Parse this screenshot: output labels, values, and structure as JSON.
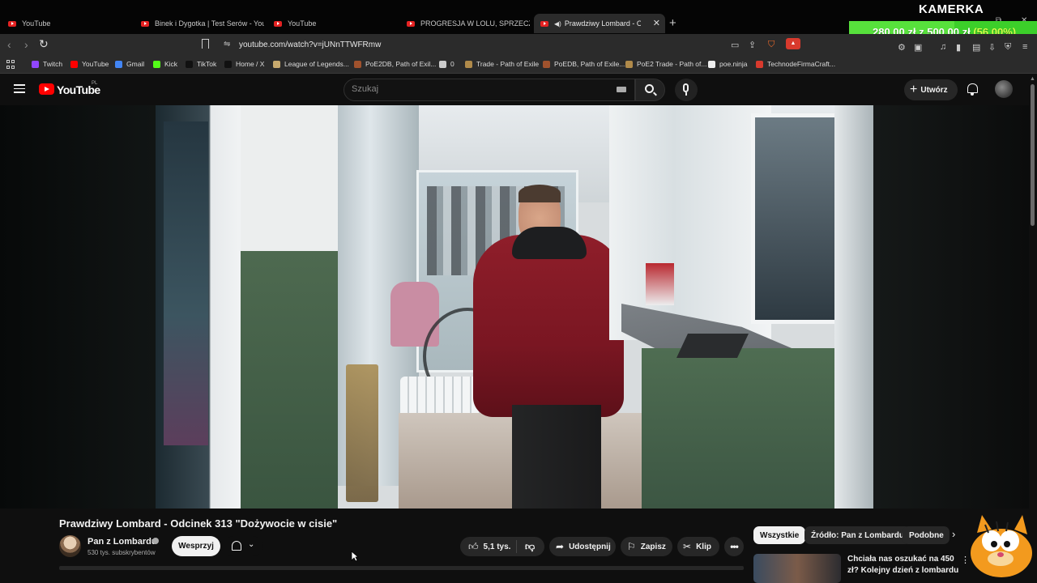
{
  "browser": {
    "tabs": [
      {
        "title": "YouTube",
        "active": false
      },
      {
        "title": "Binek i Dygotka | Test Serów - YouTube",
        "active": false
      },
      {
        "title": "YouTube",
        "active": false
      },
      {
        "title": "PROGRESJA W LOLU, SPRZECZKI Z RI",
        "active": false
      },
      {
        "title": "Prawdziwy Lombard - Odcinek",
        "active": true
      }
    ],
    "url": "youtube.com/watch?v=jUNnTTWFRmw",
    "bookmarks": [
      {
        "label": "Twitch",
        "icon": "twitch-icon",
        "color": "#9146ff"
      },
      {
        "label": "YouTube",
        "icon": "youtube-icon",
        "color": "#ff0000"
      },
      {
        "label": "Gmail",
        "icon": "google-icon",
        "color": "#4285f4"
      },
      {
        "label": "Kick",
        "icon": "kick-icon",
        "color": "#53fc18"
      },
      {
        "label": "TikTok",
        "icon": "tiktok-icon",
        "color": "#111111"
      },
      {
        "label": "Home / X",
        "icon": "x-icon",
        "color": "#111111"
      },
      {
        "label": "League of Legends...",
        "icon": "lol-icon",
        "color": "#c8aa6e"
      },
      {
        "label": "PoE2DB, Path of Exil...",
        "icon": "poe2db-icon",
        "color": "#a0522d"
      },
      {
        "label": "0",
        "icon": "folder-icon",
        "color": "#cccccc"
      },
      {
        "label": "Trade - Path of Exile",
        "icon": "poe-trade-icon",
        "color": "#b08a4a"
      },
      {
        "label": "PoEDB, Path of Exile...",
        "icon": "poedb-icon",
        "color": "#a0522d"
      },
      {
        "label": "PoE2 Trade - Path of...",
        "icon": "poe2-trade-icon",
        "color": "#b08a4a"
      },
      {
        "label": "poe.ninja",
        "icon": "poe-ninja-icon",
        "color": "#eeeeee"
      },
      {
        "label": "TechnodeFirmaCraft...",
        "icon": "technode-icon",
        "color": "#d83a2d"
      }
    ]
  },
  "overlay": {
    "camera_label": "KAMERKA",
    "donation_text": "280,00 zł z 500,00 zł",
    "donation_percent_label": "(56.00%)",
    "donation_progress": 0.56
  },
  "youtube": {
    "logo_text": "YouTube",
    "country_code": "PL",
    "search_placeholder": "Szukaj",
    "create_label": "Utwórz",
    "video": {
      "title": "Prawdziwy Lombard - Odcinek 313 \"Dożywocie w cisie\"",
      "channel": "Pan z Lombardu",
      "subscribers": "530 tys. subskrybentów",
      "support_label": "Wesprzyj",
      "likes": "5,1 tys.",
      "share_label": "Udostępnij",
      "save_label": "Zapisz",
      "clip_label": "Klip"
    },
    "chips": [
      {
        "label": "Wszystkie",
        "active": true
      },
      {
        "label": "Źródło: Pan z Lombardu",
        "active": false
      },
      {
        "label": "Podobne",
        "active": false
      }
    ],
    "recommendation": {
      "title": "Chciała nas oszukać na 450 zł? Kolejny dzień z lombardu"
    }
  }
}
